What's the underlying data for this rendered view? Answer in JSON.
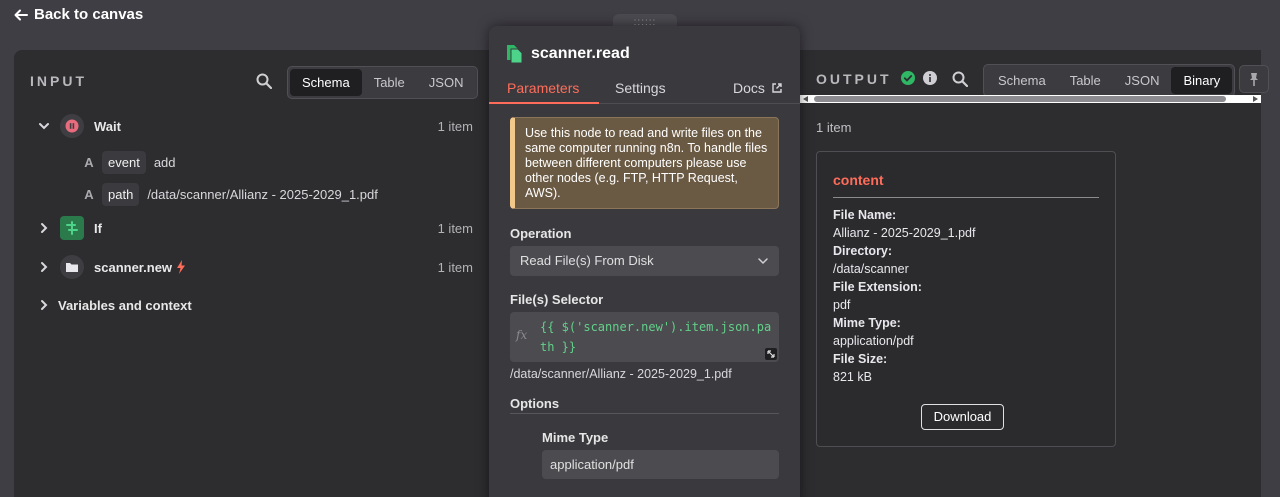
{
  "nav": {
    "back_label": "Back to canvas"
  },
  "input": {
    "title": "INPUT",
    "views": [
      "Schema",
      "Table",
      "JSON"
    ],
    "active_view": "Schema",
    "nodes": [
      {
        "name": "Wait",
        "count": "1 item"
      },
      {
        "name": "If",
        "count": "1 item"
      },
      {
        "name": "scanner.new",
        "count": "1 item"
      }
    ],
    "fields": [
      {
        "type": "A",
        "name": "event",
        "value": "add"
      },
      {
        "type": "A",
        "name": "path",
        "value": "/data/scanner/Allianz - 2025-2029_1.pdf"
      }
    ],
    "variables_label": "Variables and context"
  },
  "node": {
    "handle": "::::::",
    "title": "scanner.read",
    "tabs": {
      "parameters": "Parameters",
      "settings": "Settings",
      "docs": "Docs"
    },
    "notice": "Use this node to read and write files on the same computer running n8n. To handle files between different computers please use other nodes (e.g. FTP, HTTP Request, AWS).",
    "operation_label": "Operation",
    "operation_value": "Read File(s) From Disk",
    "selector_label": "File(s) Selector",
    "selector_fx": "fx",
    "selector_expr": "{{ $('scanner.new').item.json.path }}",
    "selector_preview": "/data/scanner/Allianz - 2025-2029_1.pdf",
    "options_label": "Options",
    "mime_label": "Mime Type",
    "mime_value": "application/pdf"
  },
  "output": {
    "title": "OUTPUT",
    "views": [
      "Schema",
      "Table",
      "JSON",
      "Binary"
    ],
    "active_view": "Binary",
    "item_count": "1 item",
    "card": {
      "title": "content",
      "file_name_label": "File Name:",
      "file_name": "Allianz - 2025-2029_1.pdf",
      "directory_label": "Directory:",
      "directory": "/data/scanner",
      "extension_label": "File Extension:",
      "extension": "pdf",
      "mime_label": "Mime Type:",
      "mime": "application/pdf",
      "size_label": "File Size:",
      "size": "821 kB",
      "download_label": "Download"
    }
  },
  "colors": {
    "accent": "#ff6d5a",
    "success": "#2fb765",
    "expression": "#63d08a",
    "notice_bg": "#6b5a43"
  }
}
